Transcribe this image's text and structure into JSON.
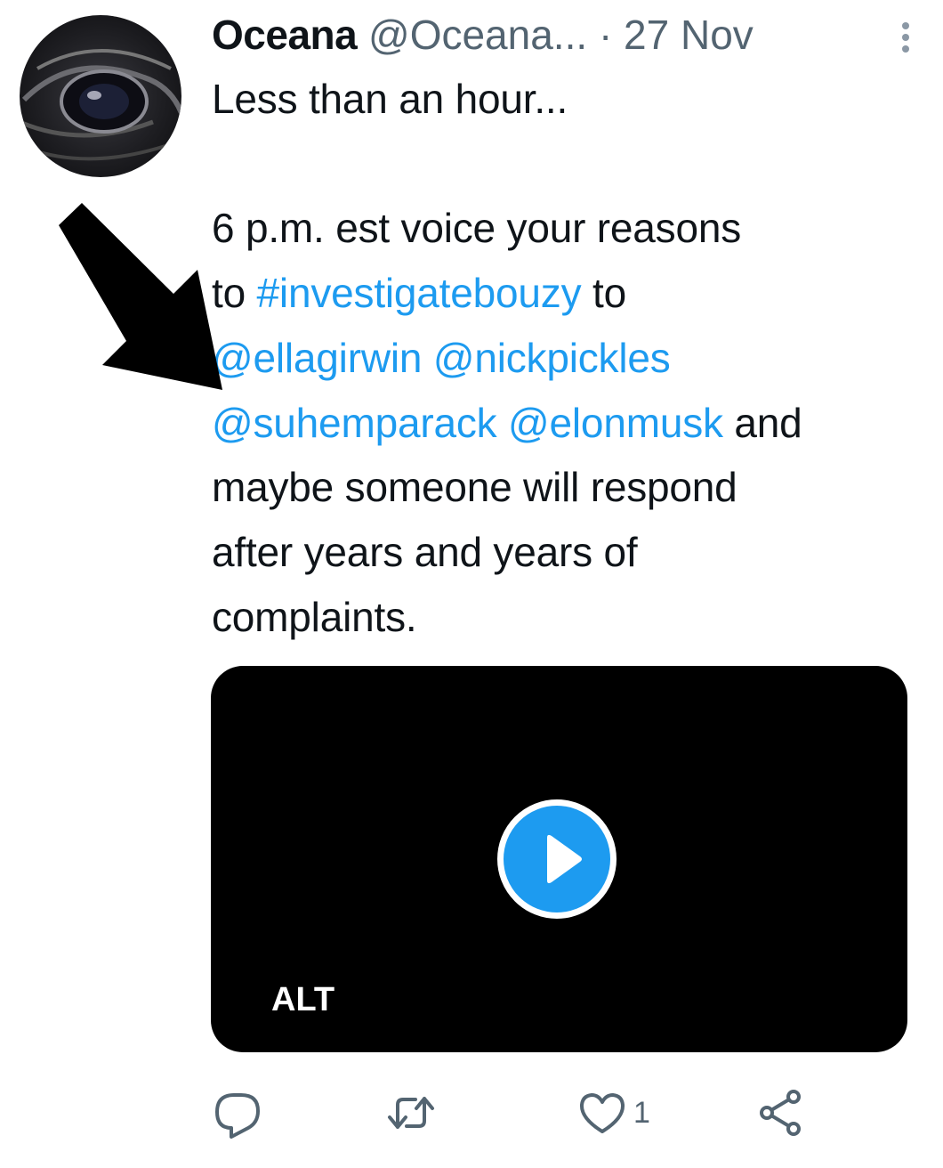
{
  "tweet": {
    "display_name": "Oceana",
    "handle": "@Oceana...",
    "separator": "·",
    "date": "27 Nov",
    "line1": "Less than an hour...",
    "body": {
      "seg1": "6 p.m. est voice your reasons",
      "seg2": "to ",
      "hashtag": "#investigatebouzy",
      "seg3": " to",
      "mention1": "@ellagirwin",
      "mention2": "@nickpickles",
      "mention3": "@suhemparack",
      "mention4": "@elonmusk",
      "seg4": " and",
      "seg5": "maybe someone will respond",
      "seg6": "after years and years of",
      "seg7": "complaints."
    },
    "media": {
      "alt_label": "ALT"
    },
    "actions": {
      "like_count": "1"
    }
  },
  "colors": {
    "link": "#1d9bf0",
    "secondary": "#536471",
    "text": "#0f1419"
  },
  "icons": [
    "more-vertical-icon",
    "play-icon",
    "reply-icon",
    "retweet-icon",
    "heart-icon",
    "share-icon",
    "arrow-annotation"
  ]
}
